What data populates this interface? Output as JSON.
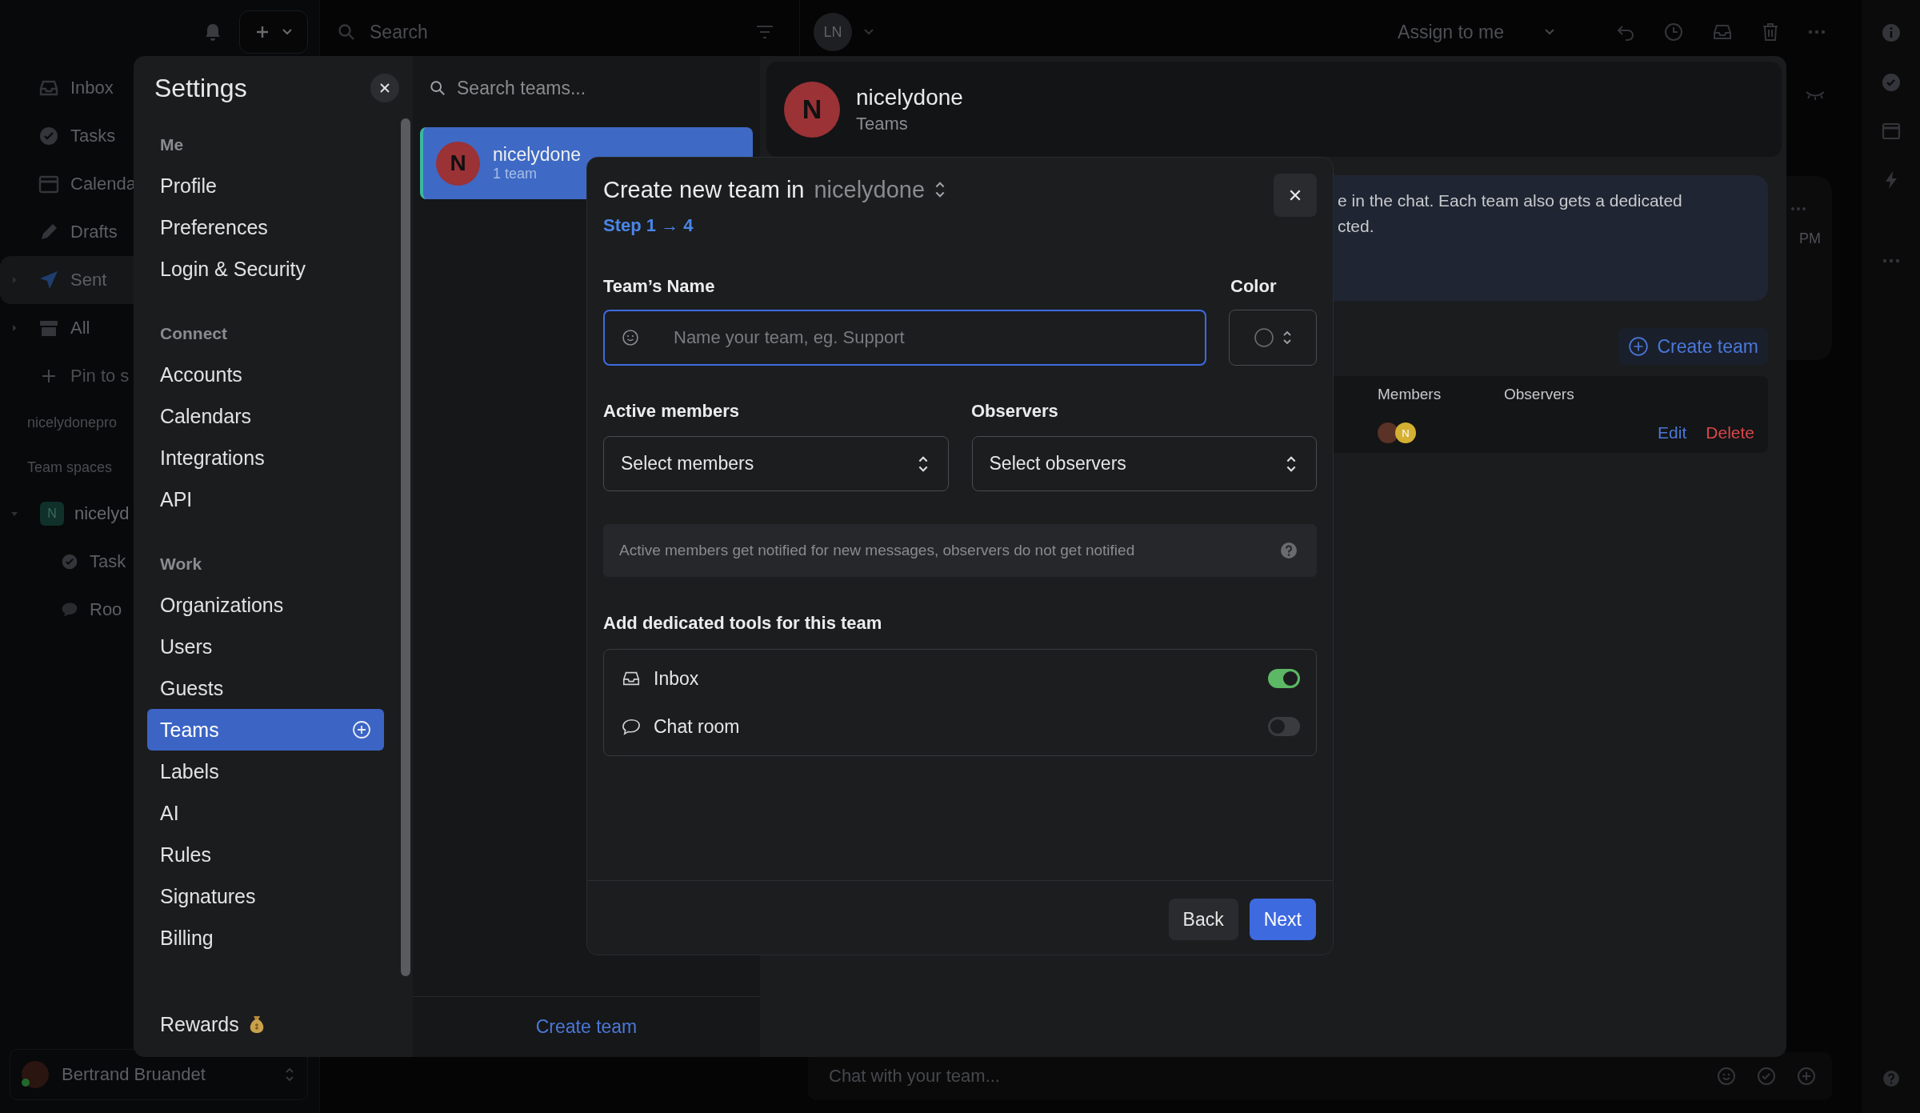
{
  "sidebar": {
    "items": [
      {
        "label": "Inbox",
        "selected": false
      },
      {
        "label": "Tasks",
        "selected": false
      },
      {
        "label": "Calenda",
        "selected": false
      },
      {
        "label": "Drafts",
        "selected": false
      },
      {
        "label": "Sent",
        "selected": true,
        "expanded": false
      },
      {
        "label": "All",
        "selected": false,
        "expanded": false
      }
    ],
    "pin": "Pin to s",
    "workspace": "nicelydonepro",
    "section": "Team spaces",
    "team": {
      "badge": "N",
      "label": "nicelyd",
      "expanded": true,
      "children": [
        {
          "label": "Task"
        },
        {
          "label": "Roo"
        }
      ]
    },
    "user": {
      "name": "Bertrand Bruandet",
      "online": true
    }
  },
  "list_bar": {
    "placeholder": "Search"
  },
  "conversation": {
    "avatar": "LN",
    "assign": "Assign to me",
    "time": "PM",
    "chat_placeholder": "Chat with your team..."
  },
  "settings": {
    "title": "Settings",
    "sections": [
      {
        "heading": "Me",
        "items": [
          {
            "label": "Profile",
            "selected": false
          },
          {
            "label": "Preferences",
            "selected": false
          },
          {
            "label": "Login & Security",
            "selected": false
          }
        ]
      },
      {
        "heading": "Connect",
        "items": [
          {
            "label": "Accounts",
            "selected": false
          },
          {
            "label": "Calendars",
            "selected": false
          },
          {
            "label": "Integrations",
            "selected": false
          },
          {
            "label": "API",
            "selected": false
          }
        ]
      },
      {
        "heading": "Work",
        "items": [
          {
            "label": "Organizations",
            "selected": false
          },
          {
            "label": "Users",
            "selected": false
          },
          {
            "label": "Guests",
            "selected": false
          },
          {
            "label": "Teams",
            "selected": true
          },
          {
            "label": "Labels",
            "selected": false
          },
          {
            "label": "AI",
            "selected": false
          },
          {
            "label": "Rules",
            "selected": false
          },
          {
            "label": "Signatures",
            "selected": false
          },
          {
            "label": "Billing",
            "selected": false
          }
        ]
      }
    ],
    "footer_item": "Rewards"
  },
  "teams_panel": {
    "placeholder": "Search teams...",
    "teams": [
      {
        "initial": "N",
        "name": "nicelydone",
        "count": "1 team",
        "selected": true
      }
    ],
    "create_link": "Create team"
  },
  "content": {
    "org": {
      "initial": "N",
      "name": "nicelydone",
      "subtitle": "Teams"
    },
    "info_lines": [
      "e in the chat. Each team also gets a dedicated",
      "cted."
    ],
    "create_button": "Create team",
    "table": {
      "columns": [
        "Members",
        "Observers"
      ],
      "rows": [
        {
          "avatars": [
            {
              "color": "#5a3326"
            },
            {
              "initials": "N",
              "color": "#d4b032"
            }
          ],
          "actions": [
            {
              "label": "Edit",
              "kind": "edit"
            },
            {
              "label": "Delete",
              "kind": "delete"
            }
          ]
        }
      ]
    }
  },
  "dialog": {
    "title": "Create new team in",
    "org": "nicelydone",
    "step": "Step 1 → 4",
    "name_label": "Team’s Name",
    "name_placeholder": "Name your team, eg. Support",
    "color_label": "Color",
    "members_label": "Active members",
    "members_placeholder": "Select members",
    "observers_label": "Observers",
    "observers_placeholder": "Select observers",
    "note": "Active members get notified for new messages, observers do not get notified",
    "tools_heading": "Add dedicated tools for this team",
    "tools": [
      {
        "label": "Inbox",
        "on": true
      },
      {
        "label": "Chat room",
        "on": false
      }
    ],
    "buttons": [
      {
        "label": "Back",
        "kind": "secondary"
      },
      {
        "label": "Next",
        "kind": "primary"
      }
    ]
  }
}
